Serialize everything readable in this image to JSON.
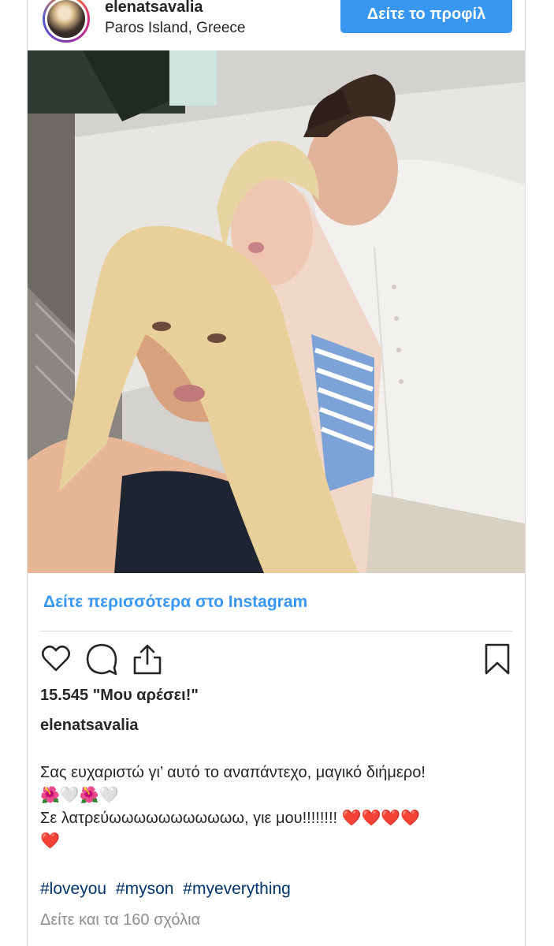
{
  "header": {
    "username": "elenatsavalia",
    "location": "Paros Island, Greece",
    "profile_button": "Δείτε το προφίλ"
  },
  "photo": {
    "description_icon": "photo"
  },
  "view_more": "Δείτε περισσότερα στο Instagram",
  "actions": {
    "icons": [
      "heart-icon",
      "comment-icon",
      "share-icon",
      "bookmark-icon"
    ]
  },
  "likes": "15.545 \"Μου αρέσει!\"",
  "caption": {
    "username": "elenatsavalia",
    "line1": "Σας ευχαριστώ γι’ αυτό το αναπάντεχο, μαγικό διήμερο!",
    "line2": "🌺🤍🌺🤍",
    "line3": "Σε λατρεύωωωωωωωωωωω, γιε μου!!!!!!!! ❤️❤️❤️❤️",
    "line4": "❤️"
  },
  "hashtags": [
    "#loveyou",
    "#myson",
    "#myeverything"
  ],
  "comments_link": "Δείτε και τα 160 σχόλια",
  "colors": {
    "accent": "#3897f0",
    "hashtag": "#003569",
    "muted": "#8e8e8e"
  }
}
